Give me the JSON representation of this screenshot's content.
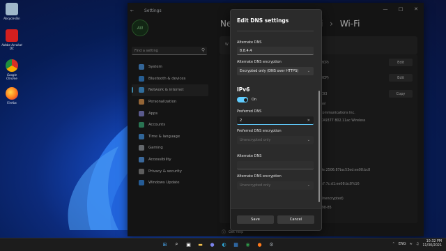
{
  "desktop": {
    "icons": [
      {
        "label": "Recycle Bin",
        "icon": "recycle-bin-icon",
        "color": "#9fb7c9"
      },
      {
        "label": "Adobe Acrobat DC",
        "icon": "acrobat-icon",
        "color": "#d31f1f"
      },
      {
        "label": "Google Chrome",
        "icon": "chrome-icon",
        "color": "#2f9b4a"
      },
      {
        "label": "Firefox",
        "icon": "firefox-icon",
        "color": "#ff7a1a"
      }
    ]
  },
  "settings": {
    "title": "Settings",
    "avatar_text": "AN",
    "search_placeholder": "Find a setting",
    "breadcrumb_ne": "Ne",
    "breadcrumb_i": "i",
    "breadcrumb_wifi": "Wi-Fi",
    "nav": [
      {
        "label": "System",
        "icon": "system-icon",
        "color": "#4f9be8"
      },
      {
        "label": "Bluetooth & devices",
        "icon": "bluetooth-icon",
        "color": "#3b8fe0"
      },
      {
        "label": "Network & internet",
        "icon": "network-icon",
        "color": "#4aa8f0",
        "active": true
      },
      {
        "label": "Personalization",
        "icon": "personalization-icon",
        "color": "#e39b54"
      },
      {
        "label": "Apps",
        "icon": "apps-icon",
        "color": "#8a8ad8"
      },
      {
        "label": "Accounts",
        "icon": "accounts-icon",
        "color": "#3fb27f"
      },
      {
        "label": "Time & language",
        "icon": "time-language-icon",
        "color": "#4b9be8"
      },
      {
        "label": "Gaming",
        "icon": "gaming-icon",
        "color": "#9aa0a6"
      },
      {
        "label": "Accessibility",
        "icon": "accessibility-icon",
        "color": "#5aa0ee"
      },
      {
        "label": "Privacy & security",
        "icon": "privacy-icon",
        "color": "#8f8f8f"
      },
      {
        "label": "Windows Update",
        "icon": "windows-update-icon",
        "color": "#3a8ee6"
      }
    ],
    "panel_row_letter": "W",
    "right_rows": {
      "dhcp1": "HCP)",
      "dhcp2": "HCP)",
      "edit1": "Edit",
      "edit2": "Edit",
      "copy": "Copy",
      "c93": "C93",
      "nal": "nal",
      "communications": "communications Inc.",
      "wireless": "CA9377 802.11ac Wireless",
      "ipv6a": "8e:2506:87ba:53ed:ee08:bc8",
      "ipv6b": "a7:7c:d1:ee08:bc8%16",
      "unencrypted": "Unencrypted)",
      "mac": "-98-85"
    },
    "help_label": "Get help"
  },
  "dialog": {
    "title": "Edit DNS settings",
    "alt_dns_label": "Alternate DNS",
    "alt_dns_value": "8.8.4.4",
    "alt_enc_label": "Alternate DNS encryption",
    "alt_enc_value": "Encrypted only (DNS over HTTPS)",
    "ipv6_heading": "IPv6",
    "ipv6_toggle_label": "On",
    "pref_dns_label": "Preferred DNS",
    "pref_dns_value": "2",
    "pref_enc_label": "Preferred DNS encryption",
    "pref_enc_value": "Unencrypted only",
    "alt6_dns_label": "Alternate DNS",
    "alt6_dns_value": "",
    "alt6_enc_label": "Alternate DNS encryption",
    "alt6_enc_value": "Unencrypted only",
    "save_label": "Save",
    "cancel_label": "Cancel"
  },
  "taskbar": {
    "icons": [
      {
        "name": "start-icon",
        "color": "#4aa8f0"
      },
      {
        "name": "search-icon",
        "color": "#ffffff"
      },
      {
        "name": "task-view-icon",
        "color": "#ffffff"
      },
      {
        "name": "file-explorer-icon",
        "color": "#f2c14e"
      },
      {
        "name": "chat-icon",
        "color": "#7b83eb"
      },
      {
        "name": "edge-icon",
        "color": "#2fa7d8"
      },
      {
        "name": "store-icon",
        "color": "#3a8ee6"
      },
      {
        "name": "chrome-icon",
        "color": "#2f9b4a"
      },
      {
        "name": "firefox-icon",
        "color": "#ff7a1a"
      },
      {
        "name": "settings-icon",
        "color": "#9aa0a6"
      }
    ],
    "lang": "ENG",
    "time": "10:32 PM",
    "date": "11/30/2021"
  }
}
